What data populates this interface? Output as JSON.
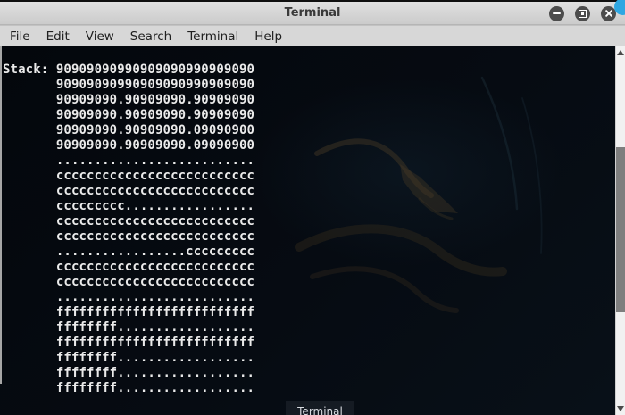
{
  "window": {
    "title": "Terminal",
    "controls": [
      "minimize",
      "maximize",
      "close"
    ],
    "badge_color": "#2fa7e2"
  },
  "menu": {
    "items": [
      "File",
      "Edit",
      "View",
      "Search",
      "Terminal",
      "Help"
    ]
  },
  "terminal": {
    "label": "Stack:",
    "lines": [
      "90909090990909090990909090",
      "90909090990909090990909090",
      "90909090.90909090.90909090",
      "90909090.90909090.90909090",
      "90909090.90909090.09090900",
      "90909090.90909090.09090900",
      "..........................",
      "cccccccccccccccccccccccccc",
      "cccccccccccccccccccccccccc",
      "ccccccccc.................",
      "cccccccccccccccccccccccccc",
      "cccccccccccccccccccccccccc",
      ".................ccccccccc",
      "cccccccccccccccccccccccccc",
      "cccccccccccccccccccccccccc",
      "..........................",
      "ffffffffffffffffffffffffff",
      "ffffffff..................",
      "ffffffffffffffffffffffffff",
      "ffffffff..................",
      "ffffffff..................",
      "ffffffff.................."
    ],
    "background": "#060b12",
    "text_color": "#eaeaea"
  },
  "taskbar_hint": {
    "label": "Terminal"
  },
  "accents": {
    "titlebar": "#d6d6d6",
    "scroll_thumb": "#7e7e7e"
  }
}
